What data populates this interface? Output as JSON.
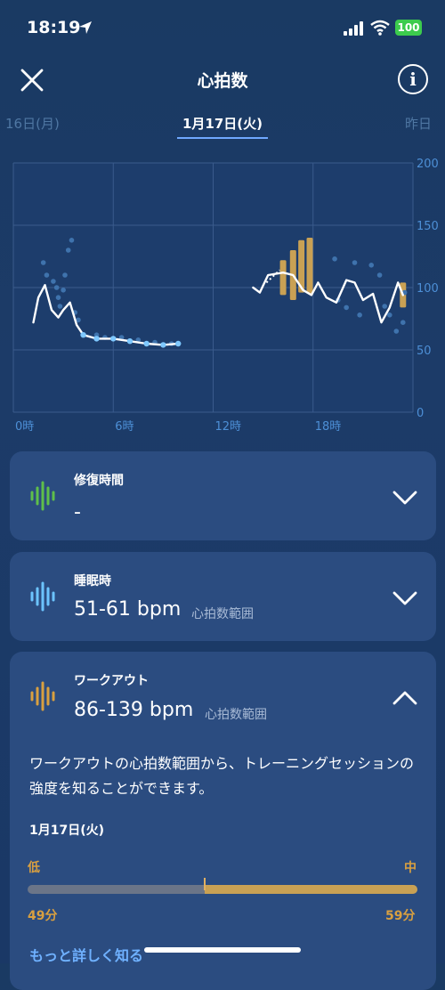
{
  "status": {
    "time": "18:19",
    "battery": "100"
  },
  "header": {
    "title": "心拍数",
    "info_glyph": "i"
  },
  "tabs": {
    "prev": "16日(月)",
    "current": "1月17日(火)",
    "next": "昨日"
  },
  "chart_data": {
    "type": "line",
    "x_ticks": [
      "0時",
      "6時",
      "12時",
      "18時"
    ],
    "y_ticks": [
      "200",
      "150",
      "100",
      "50",
      "0"
    ],
    "xlim": [
      0,
      24
    ],
    "ylim": [
      0,
      200
    ],
    "series": [
      {
        "values": [
          [
            1.2,
            72
          ],
          [
            1.5,
            92
          ],
          [
            1.9,
            102
          ],
          [
            2.3,
            82
          ],
          [
            2.7,
            76
          ],
          [
            3.0,
            82
          ],
          [
            3.4,
            88
          ],
          [
            3.8,
            70
          ],
          [
            4.2,
            62
          ],
          [
            5.0,
            59
          ],
          [
            6.0,
            59
          ],
          [
            7.0,
            57
          ],
          [
            8.0,
            55
          ],
          [
            9.0,
            54
          ],
          [
            9.9,
            55
          ]
        ]
      },
      {
        "values": [
          [
            14.4,
            100
          ],
          [
            14.8,
            96
          ],
          [
            15.3,
            110
          ],
          [
            16.2,
            112
          ],
          [
            16.8,
            110
          ],
          [
            17.4,
            98
          ],
          [
            17.9,
            94
          ],
          [
            18.3,
            104
          ],
          [
            18.8,
            92
          ],
          [
            19.4,
            88
          ],
          [
            20.0,
            106
          ],
          [
            20.5,
            104
          ],
          [
            21.0,
            90
          ],
          [
            21.6,
            95
          ],
          [
            22.1,
            72
          ],
          [
            22.6,
            84
          ],
          [
            23.1,
            104
          ],
          [
            23.4,
            94
          ]
        ]
      }
    ],
    "workout_segments": [
      [
        16.2,
        94,
        122
      ],
      [
        16.8,
        90,
        130
      ],
      [
        17.3,
        96,
        138
      ],
      [
        17.8,
        95,
        140
      ],
      [
        23.4,
        84,
        104
      ]
    ],
    "scatter_points": [
      [
        1.8,
        120
      ],
      [
        2.0,
        110
      ],
      [
        2.4,
        105
      ],
      [
        2.6,
        100
      ],
      [
        2.7,
        92
      ],
      [
        2.8,
        85
      ],
      [
        3.0,
        98
      ],
      [
        3.1,
        110
      ],
      [
        3.3,
        130
      ],
      [
        3.5,
        138
      ],
      [
        3.7,
        80
      ],
      [
        3.9,
        74
      ],
      [
        5.0,
        62
      ],
      [
        5.5,
        60
      ],
      [
        6.5,
        60
      ],
      [
        7.5,
        58
      ],
      [
        8.5,
        56
      ],
      [
        9.5,
        55
      ],
      [
        19.3,
        123
      ],
      [
        19.5,
        90
      ],
      [
        20.0,
        84
      ],
      [
        20.5,
        120
      ],
      [
        20.8,
        78
      ],
      [
        21.5,
        118
      ],
      [
        22.0,
        110
      ],
      [
        22.3,
        85
      ],
      [
        22.6,
        78
      ],
      [
        23.0,
        65
      ],
      [
        23.4,
        72
      ],
      [
        23.5,
        96
      ]
    ]
  },
  "cards": {
    "recovery": {
      "label": "修復時間",
      "value": "-"
    },
    "sleep": {
      "label": "睡眠時",
      "value": "51-61 bpm",
      "sub": "心拍数範囲"
    },
    "workout": {
      "label": "ワークアウト",
      "value": "86-139 bpm",
      "sub": "心拍数範囲",
      "description": "ワークアウトの心拍数範囲から、トレーニングセッションの強度を知ることができます。",
      "date": "1月17日(火)",
      "low_label": "低",
      "mid_label": "中",
      "low_minutes": "49分",
      "mid_minutes": "59分",
      "low_fraction": 0.454,
      "learn_more": "もっと詳しく知る"
    }
  },
  "colors": {
    "accent_green": "#5fbf4a",
    "accent_blue": "#6cc4ff",
    "accent_orange": "#d9a040",
    "chart_line": "#ffffff"
  }
}
